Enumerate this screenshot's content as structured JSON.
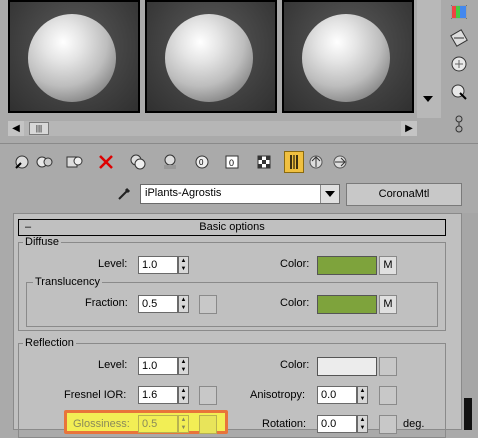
{
  "material": {
    "name": "iPlants-Agrostis",
    "type_button": "CoronaMtl"
  },
  "icons": {
    "eyedropper": "eyedropper-icon",
    "dropdown": "chevron-down-icon"
  },
  "rollout": {
    "collapse_sign": "–",
    "title": "Basic options"
  },
  "diffuse": {
    "title": "Diffuse",
    "level_label": "Level:",
    "level_value": "1.0",
    "color_label": "Color:",
    "color": "#7ea33c",
    "map_label": "M"
  },
  "translucency": {
    "title": "Translucency",
    "fraction_label": "Fraction:",
    "fraction_value": "0.5",
    "color_label": "Color:",
    "color": "#7ea33c",
    "map_label": "M"
  },
  "reflection": {
    "title": "Reflection",
    "level_label": "Level:",
    "level_value": "1.0",
    "color_label": "Color:",
    "color": "#ececec",
    "fresnel_label": "Fresnel IOR:",
    "fresnel_value": "1.6",
    "anisotropy_label": "Anisotropy:",
    "anisotropy_value": "0.0",
    "glossiness_label": "Glossiness:",
    "glossiness_value": "0.5",
    "rotation_label": "Rotation:",
    "rotation_value": "0.0",
    "rotation_unit": "deg."
  },
  "colors": {
    "highlight_fill": "#f2ee55",
    "highlight_border": "#e8743a"
  }
}
